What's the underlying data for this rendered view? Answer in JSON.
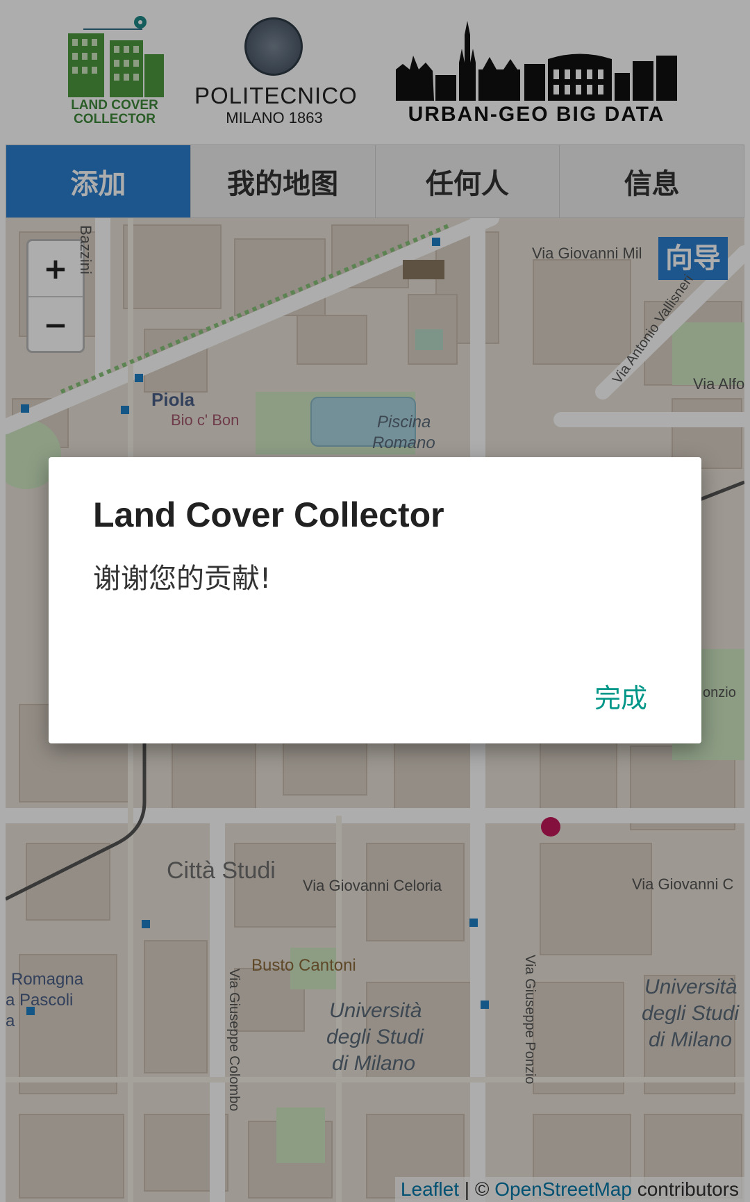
{
  "header": {
    "logo_left_line1": "LAND COVER",
    "logo_left_line2": "COLLECTOR",
    "logo_center_name": "POLITECNICO",
    "logo_center_sub": "MILANO 1863",
    "logo_right_text": "URBAN-GEO BIG DATA"
  },
  "tabs": [
    {
      "label": "添加",
      "active": true
    },
    {
      "label": "我的地图",
      "active": false
    },
    {
      "label": "任何人",
      "active": false
    },
    {
      "label": "信息",
      "active": false
    }
  ],
  "map": {
    "zoom_in": "+",
    "zoom_out": "−",
    "guide_label": "向导",
    "labels": {
      "bazzini": "Bazzini",
      "via_giovanni_mil": "Via Giovanni Mil",
      "via_antonio_vallisneri": "Via Antonio Vallisneri",
      "via_alfo": "Via Alfo",
      "piola": "Piola",
      "bio_c_bon": "Bio c' Bon",
      "piscina": "Piscina",
      "romano": "Romano",
      "citta_studi": "Città Studi",
      "via_giovanni_celoria": "Via Giovanni Celoria",
      "via_giovanni_c": "Via Giovanni C",
      "romagna": "Romagna",
      "a_pascoli": "a Pascoli",
      "a": "a",
      "busto_cantoni": "Busto Cantoni",
      "via_giuseppe_colombo": "Via Giuseppe Colombo",
      "via_giuseppe_ponzio": "Via Giuseppe Ponzio",
      "univ1_l1": "Università",
      "univ1_l2": "degli Studi",
      "univ1_l3": "di Milano",
      "univ2_l1": "Università",
      "univ2_l2": "degli Studi",
      "univ2_l3": "di Milano",
      "onzio": "onzio"
    },
    "attribution": {
      "leaflet": "Leaflet",
      "sep": " | © ",
      "osm": "OpenStreetMap",
      "contributors": " contributors"
    }
  },
  "dialog": {
    "title": "Land Cover Collector",
    "message": "谢谢您的贡献!",
    "ok_label": "完成"
  },
  "colors": {
    "tab_active": "#2a7fcf",
    "dialog_button": "#009688",
    "logo_green": "#3f8a3a"
  }
}
